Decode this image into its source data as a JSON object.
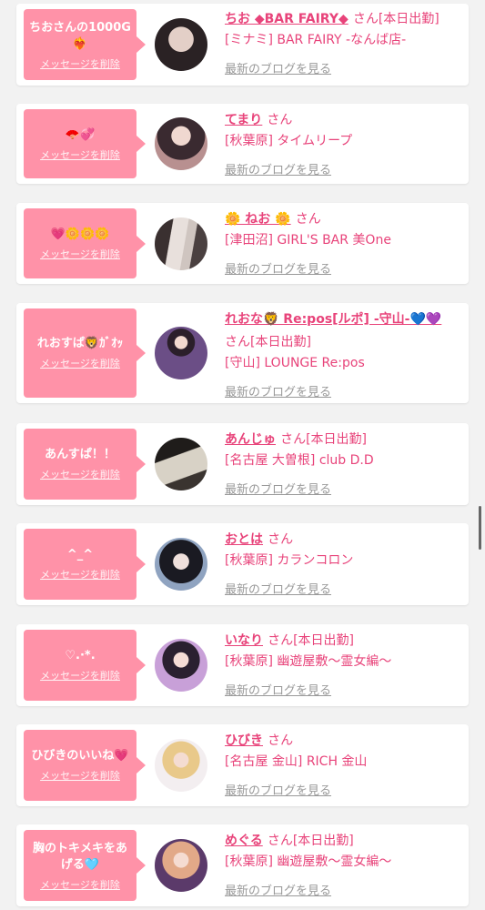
{
  "colors": {
    "accent": "#e8437a",
    "bubble": "#ff92a8",
    "muted": "#999999"
  },
  "labels": {
    "delete": "メッセージを削除",
    "blog": "最新のブログを見る",
    "san": "さん"
  },
  "items": [
    {
      "message": "ちおさんの1000G❤️‍🔥",
      "name": "ちお ◆BAR FAIRY◆",
      "status": "[本日出勤]",
      "shop": "[ミナミ] BAR FAIRY -なんば店-"
    },
    {
      "message": "🪭💞",
      "name": "てまり",
      "status": "",
      "shop": "[秋葉原] タイムリープ"
    },
    {
      "message": "💗🌼🌼🌼",
      "name": "🌼 ねお 🌼",
      "status": "",
      "shop": "[津田沼] GIRL'S BAR 美One"
    },
    {
      "message": "れおすぱ🦁ｶﾞｵｯ",
      "name": "れおな🦁 Re:pos[ルポ] -守山-💙💜",
      "status": "[本日出勤]",
      "shop": "[守山] LOUNGE Re:pos"
    },
    {
      "message": "あんすぱ！！",
      "name": "あんじゅ",
      "status": "[本日出勤]",
      "shop": "[名古屋 大曽根] club D.D"
    },
    {
      "message": "^_^",
      "name": "おとは",
      "status": "",
      "shop": "[秋葉原] カランコロン"
    },
    {
      "message": "♡.·*.",
      "name": "いなり",
      "status": "[本日出勤]",
      "shop": "[秋葉原] 幽遊屋敷〜霊女編〜"
    },
    {
      "message": "ひびきのいいね💗",
      "name": "ひびき",
      "status": "",
      "shop": "[名古屋 金山] RICH 金山"
    },
    {
      "message": "胸のトキメキをあげる🩵",
      "name": "めぐる",
      "status": "[本日出勤]",
      "shop": "[秋葉原] 幽遊屋敷〜霊女編〜"
    }
  ]
}
